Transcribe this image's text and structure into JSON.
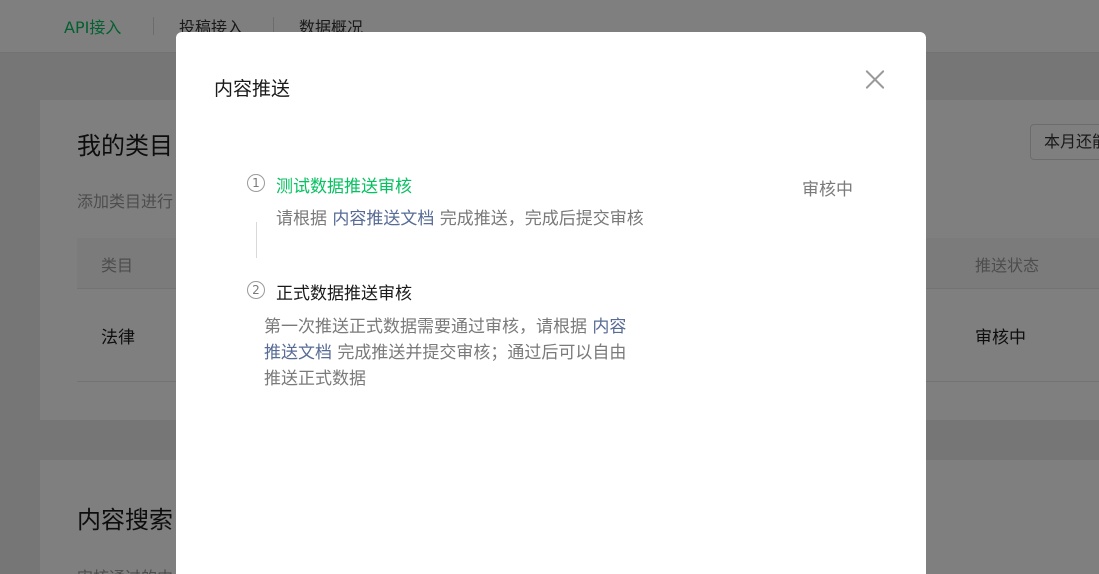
{
  "topnav": {
    "tabs": [
      {
        "label": "API接入",
        "active": true
      },
      {
        "label": "投稿接入",
        "active": false
      },
      {
        "label": "数据概况",
        "active": false
      }
    ]
  },
  "category_card": {
    "title": "我的类目",
    "description": "添加类目进行",
    "month_select": "本月还能",
    "table": {
      "headers": [
        "类目",
        "推送状态"
      ],
      "rows": [
        {
          "category": "法律",
          "status": "审核中"
        }
      ]
    }
  },
  "search_card": {
    "title": "内容搜索",
    "description": "审核通过的内"
  },
  "modal": {
    "title": "内容推送",
    "steps": [
      {
        "number": "1",
        "title": "测试数据推送审核",
        "status": "审核中",
        "desc_before": "请根据 ",
        "desc_link": "内容推送文档",
        "desc_after": " 完成推送，完成后提交审核"
      },
      {
        "number": "2",
        "title": "正式数据推送审核",
        "desc_line1_before": "第一次推送正式数据需要通过审核，请根据 ",
        "desc_line1_link": "内容",
        "desc_line2_link": "推送文档",
        "desc_line2_after": " 完成推送并提交审核；通过后可以自由",
        "desc_line3": "推送正式数据"
      }
    ]
  },
  "colors": {
    "accent_green": "#07c160",
    "link_blue": "#576b95",
    "overlay": "rgba(0,0,0,0.5)"
  },
  "icons": {
    "close": "close-icon"
  }
}
